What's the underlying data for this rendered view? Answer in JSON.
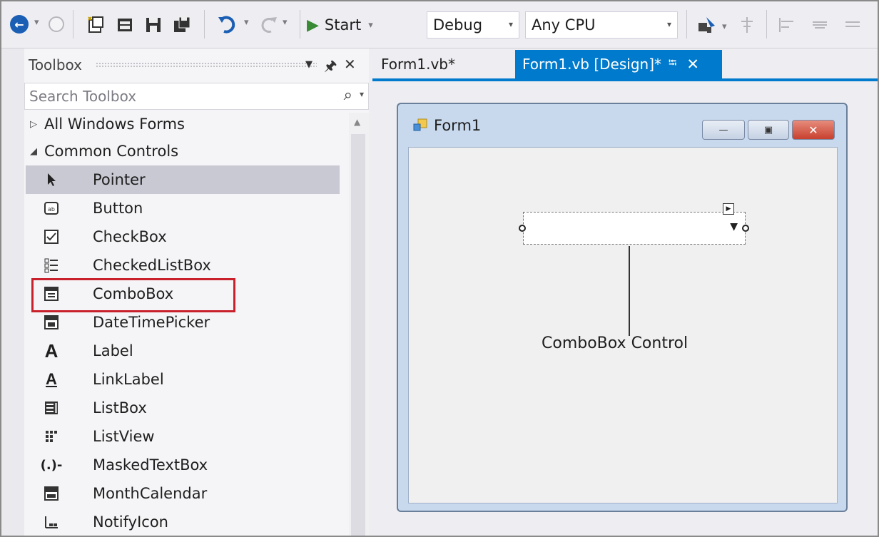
{
  "toolbar": {
    "start_label": "Start",
    "configuration": "Debug",
    "platform": "Any CPU",
    "icons": [
      "back-icon",
      "forward-icon",
      "new-project-icon",
      "open-file-icon",
      "save-icon",
      "save-all-icon",
      "undo-icon",
      "redo-icon",
      "start-play-icon",
      "find-icon",
      "align-icons"
    ]
  },
  "toolbox": {
    "title": "Toolbox",
    "search_placeholder": "Search Toolbox",
    "groups": [
      {
        "label": "All Windows Forms",
        "expanded": false
      },
      {
        "label": "Common Controls",
        "expanded": true
      }
    ],
    "items": [
      {
        "label": "Pointer",
        "icon": "pointer-icon",
        "selected": true
      },
      {
        "label": "Button",
        "icon": "button-icon"
      },
      {
        "label": "CheckBox",
        "icon": "checkbox-icon"
      },
      {
        "label": "CheckedListBox",
        "icon": "checkedlistbox-icon"
      },
      {
        "label": "ComboBox",
        "icon": "combobox-icon",
        "highlighted": true
      },
      {
        "label": "DateTimePicker",
        "icon": "datetimepicker-icon"
      },
      {
        "label": "Label",
        "icon": "label-icon"
      },
      {
        "label": "LinkLabel",
        "icon": "linklabel-icon"
      },
      {
        "label": "ListBox",
        "icon": "listbox-icon"
      },
      {
        "label": "ListView",
        "icon": "listview-icon"
      },
      {
        "label": "MaskedTextBox",
        "icon": "maskedtextbox-icon"
      },
      {
        "label": "MonthCalendar",
        "icon": "monthcalendar-icon"
      },
      {
        "label": "NotifyIcon",
        "icon": "notifyicon-icon"
      }
    ]
  },
  "tabs": [
    {
      "label": "Form1.vb*",
      "active": false
    },
    {
      "label": "Form1.vb [Design]*",
      "active": true
    }
  ],
  "form": {
    "title": "Form1",
    "callout": "ComboBox Control"
  },
  "colors": {
    "accent": "#007acc",
    "highlight_border": "#c8212c",
    "selected_row": "#c9c9d3",
    "play_green": "#388a34"
  }
}
